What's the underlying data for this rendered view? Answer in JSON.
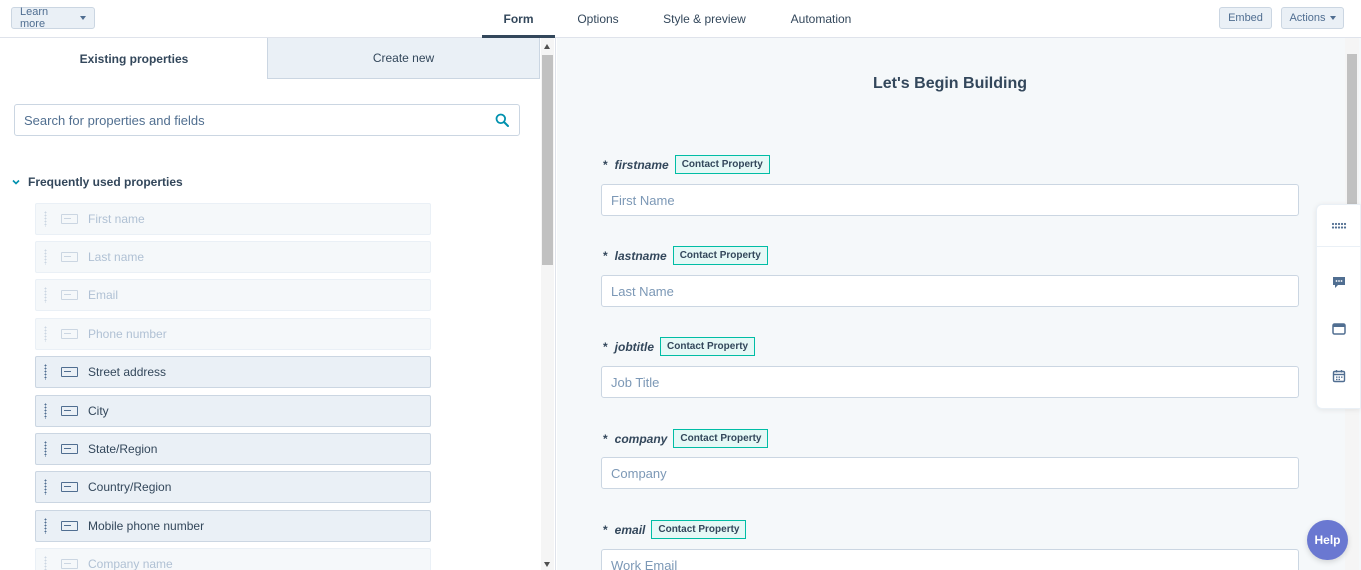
{
  "topbar": {
    "learn_more": "Learn more",
    "tabs": [
      "Form",
      "Options",
      "Style & preview",
      "Automation"
    ],
    "active_tab": "Form",
    "embed": "Embed",
    "actions": "Actions"
  },
  "left_panel": {
    "tabs": {
      "existing": "Existing properties",
      "create": "Create new"
    },
    "search": {
      "placeholder": "Search for properties and fields",
      "value": ""
    },
    "section": {
      "title": "Frequently used properties",
      "items": [
        {
          "label": "First name",
          "state": "disabled"
        },
        {
          "label": "Last name",
          "state": "disabled"
        },
        {
          "label": "Email",
          "state": "disabled"
        },
        {
          "label": "Phone number",
          "state": "disabled"
        },
        {
          "label": "Street address",
          "state": "enabled"
        },
        {
          "label": "City",
          "state": "enabled"
        },
        {
          "label": "State/Region",
          "state": "enabled"
        },
        {
          "label": "Country/Region",
          "state": "enabled"
        },
        {
          "label": "Mobile phone number",
          "state": "enabled"
        },
        {
          "label": "Company name",
          "state": "disabled"
        }
      ]
    }
  },
  "form": {
    "title": "Let's Begin Building",
    "fields": [
      {
        "name": "firstname",
        "required": "*",
        "badge": "Contact Property",
        "placeholder": "First Name"
      },
      {
        "name": "lastname",
        "required": "*",
        "badge": "Contact Property",
        "placeholder": "Last Name"
      },
      {
        "name": "jobtitle",
        "required": "*",
        "badge": "Contact Property",
        "placeholder": "Job Title"
      },
      {
        "name": "company",
        "required": "*",
        "badge": "Contact Property",
        "placeholder": "Company"
      },
      {
        "name": "email",
        "required": "*",
        "badge": "Contact Property",
        "placeholder": "Work Email"
      }
    ]
  },
  "floating_toolbar": {
    "icons": [
      "grid-dots-icon",
      "chat-icon",
      "window-icon",
      "calendar-icon"
    ]
  },
  "help": {
    "label": "Help"
  },
  "colors": {
    "accent_teal": "#00bda5",
    "text": "#33475b",
    "secondary_bg": "#eaf0f6",
    "help_button": "#6a78d1"
  }
}
